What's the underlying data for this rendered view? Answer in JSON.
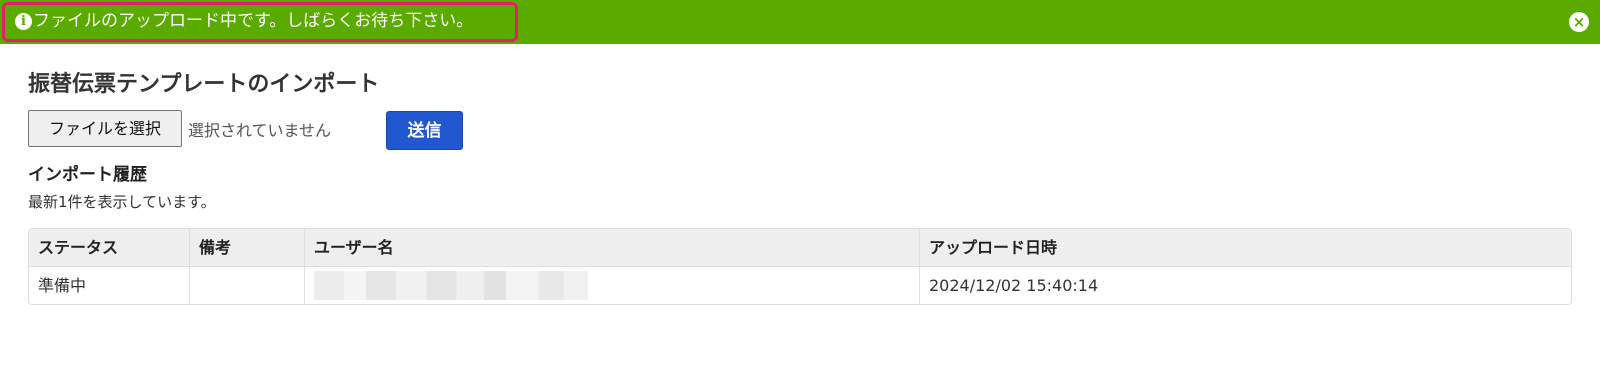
{
  "banner": {
    "message": "ファイルのアップロード中です。しばらくお待ち下さい。",
    "info_icon": "i",
    "close_icon": "×",
    "color": "#5aaa00",
    "highlight_color": "#e0206a"
  },
  "page": {
    "title": "振替伝票テンプレートのインポート"
  },
  "upload": {
    "file_button_label": "ファイルを選択",
    "file_status": "選択されていません",
    "submit_label": "送信",
    "submit_color": "#2158d0"
  },
  "history": {
    "title": "インポート履歴",
    "note": "最新1件を表示しています。",
    "columns": [
      "ステータス",
      "備考",
      "ユーザー名",
      "アップロード日時"
    ],
    "rows": [
      {
        "status": "準備中",
        "remarks": "",
        "uploaded_at": "2024/12/02 15:40:14"
      }
    ]
  }
}
